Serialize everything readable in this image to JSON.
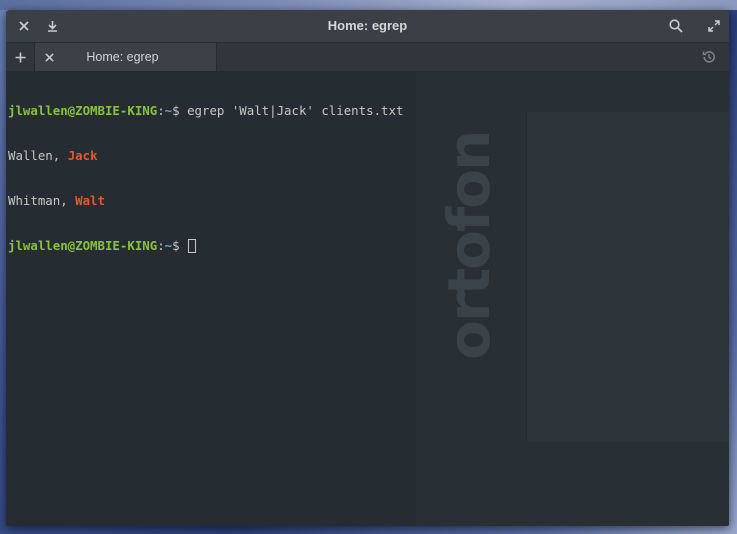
{
  "window": {
    "title": "Home: egrep"
  },
  "tabs": [
    {
      "label": "Home: egrep"
    }
  ],
  "terminal": {
    "lines": [
      {
        "type": "prompt",
        "user_host": "jlwallen@ZOMBIE-KING",
        "sep": ":",
        "path": "~",
        "dollar": "$",
        "command": " egrep 'Walt|Jack' clients.txt"
      },
      {
        "type": "match_line",
        "prefix": "Wallen, ",
        "match": "Jack"
      },
      {
        "type": "match_line",
        "prefix": "Whitman, ",
        "match": "Walt"
      },
      {
        "type": "prompt",
        "user_host": "jlwallen@ZOMBIE-KING",
        "sep": ":",
        "path": "~",
        "dollar": "$",
        "command": " "
      }
    ],
    "watermark": "ortofon"
  },
  "colors": {
    "prompt_user": "#8ac03b",
    "prompt_path": "#6e9fd6",
    "match": "#e05a2b",
    "text": "#c5c8c6",
    "background": "#283036"
  },
  "icons": {
    "close": "close-icon",
    "download": "download-icon",
    "search": "search-icon",
    "maximize": "maximize-icon",
    "new_tab": "plus-icon",
    "tab_close": "close-icon",
    "history": "history-icon"
  }
}
